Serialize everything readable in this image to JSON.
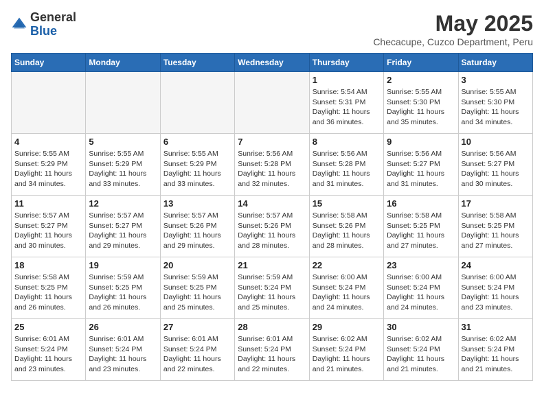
{
  "header": {
    "logo_general": "General",
    "logo_blue": "Blue",
    "month_year": "May 2025",
    "location": "Checacupe, Cuzco Department, Peru"
  },
  "days_of_week": [
    "Sunday",
    "Monday",
    "Tuesday",
    "Wednesday",
    "Thursday",
    "Friday",
    "Saturday"
  ],
  "weeks": [
    [
      {
        "day": "",
        "info": ""
      },
      {
        "day": "",
        "info": ""
      },
      {
        "day": "",
        "info": ""
      },
      {
        "day": "",
        "info": ""
      },
      {
        "day": "1",
        "info": "Sunrise: 5:54 AM\nSunset: 5:31 PM\nDaylight: 11 hours and 36 minutes."
      },
      {
        "day": "2",
        "info": "Sunrise: 5:55 AM\nSunset: 5:30 PM\nDaylight: 11 hours and 35 minutes."
      },
      {
        "day": "3",
        "info": "Sunrise: 5:55 AM\nSunset: 5:30 PM\nDaylight: 11 hours and 34 minutes."
      }
    ],
    [
      {
        "day": "4",
        "info": "Sunrise: 5:55 AM\nSunset: 5:29 PM\nDaylight: 11 hours and 34 minutes."
      },
      {
        "day": "5",
        "info": "Sunrise: 5:55 AM\nSunset: 5:29 PM\nDaylight: 11 hours and 33 minutes."
      },
      {
        "day": "6",
        "info": "Sunrise: 5:55 AM\nSunset: 5:29 PM\nDaylight: 11 hours and 33 minutes."
      },
      {
        "day": "7",
        "info": "Sunrise: 5:56 AM\nSunset: 5:28 PM\nDaylight: 11 hours and 32 minutes."
      },
      {
        "day": "8",
        "info": "Sunrise: 5:56 AM\nSunset: 5:28 PM\nDaylight: 11 hours and 31 minutes."
      },
      {
        "day": "9",
        "info": "Sunrise: 5:56 AM\nSunset: 5:27 PM\nDaylight: 11 hours and 31 minutes."
      },
      {
        "day": "10",
        "info": "Sunrise: 5:56 AM\nSunset: 5:27 PM\nDaylight: 11 hours and 30 minutes."
      }
    ],
    [
      {
        "day": "11",
        "info": "Sunrise: 5:57 AM\nSunset: 5:27 PM\nDaylight: 11 hours and 30 minutes."
      },
      {
        "day": "12",
        "info": "Sunrise: 5:57 AM\nSunset: 5:27 PM\nDaylight: 11 hours and 29 minutes."
      },
      {
        "day": "13",
        "info": "Sunrise: 5:57 AM\nSunset: 5:26 PM\nDaylight: 11 hours and 29 minutes."
      },
      {
        "day": "14",
        "info": "Sunrise: 5:57 AM\nSunset: 5:26 PM\nDaylight: 11 hours and 28 minutes."
      },
      {
        "day": "15",
        "info": "Sunrise: 5:58 AM\nSunset: 5:26 PM\nDaylight: 11 hours and 28 minutes."
      },
      {
        "day": "16",
        "info": "Sunrise: 5:58 AM\nSunset: 5:25 PM\nDaylight: 11 hours and 27 minutes."
      },
      {
        "day": "17",
        "info": "Sunrise: 5:58 AM\nSunset: 5:25 PM\nDaylight: 11 hours and 27 minutes."
      }
    ],
    [
      {
        "day": "18",
        "info": "Sunrise: 5:58 AM\nSunset: 5:25 PM\nDaylight: 11 hours and 26 minutes."
      },
      {
        "day": "19",
        "info": "Sunrise: 5:59 AM\nSunset: 5:25 PM\nDaylight: 11 hours and 26 minutes."
      },
      {
        "day": "20",
        "info": "Sunrise: 5:59 AM\nSunset: 5:25 PM\nDaylight: 11 hours and 25 minutes."
      },
      {
        "day": "21",
        "info": "Sunrise: 5:59 AM\nSunset: 5:24 PM\nDaylight: 11 hours and 25 minutes."
      },
      {
        "day": "22",
        "info": "Sunrise: 6:00 AM\nSunset: 5:24 PM\nDaylight: 11 hours and 24 minutes."
      },
      {
        "day": "23",
        "info": "Sunrise: 6:00 AM\nSunset: 5:24 PM\nDaylight: 11 hours and 24 minutes."
      },
      {
        "day": "24",
        "info": "Sunrise: 6:00 AM\nSunset: 5:24 PM\nDaylight: 11 hours and 23 minutes."
      }
    ],
    [
      {
        "day": "25",
        "info": "Sunrise: 6:01 AM\nSunset: 5:24 PM\nDaylight: 11 hours and 23 minutes."
      },
      {
        "day": "26",
        "info": "Sunrise: 6:01 AM\nSunset: 5:24 PM\nDaylight: 11 hours and 23 minutes."
      },
      {
        "day": "27",
        "info": "Sunrise: 6:01 AM\nSunset: 5:24 PM\nDaylight: 11 hours and 22 minutes."
      },
      {
        "day": "28",
        "info": "Sunrise: 6:01 AM\nSunset: 5:24 PM\nDaylight: 11 hours and 22 minutes."
      },
      {
        "day": "29",
        "info": "Sunrise: 6:02 AM\nSunset: 5:24 PM\nDaylight: 11 hours and 21 minutes."
      },
      {
        "day": "30",
        "info": "Sunrise: 6:02 AM\nSunset: 5:24 PM\nDaylight: 11 hours and 21 minutes."
      },
      {
        "day": "31",
        "info": "Sunrise: 6:02 AM\nSunset: 5:24 PM\nDaylight: 11 hours and 21 minutes."
      }
    ]
  ]
}
